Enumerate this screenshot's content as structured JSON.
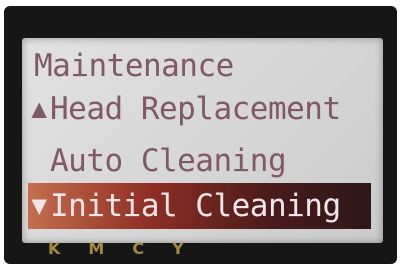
{
  "screen": {
    "title": "Maintenance",
    "menu_items": [
      {
        "label": "Head Replacement",
        "indicator": "▲"
      },
      {
        "label": "Auto Cleaning",
        "indicator": ""
      },
      {
        "label": "Initial Cleaning",
        "indicator": "▼",
        "selected": true
      }
    ]
  },
  "ink_labels": [
    "K",
    "M",
    "C",
    "Y"
  ],
  "colors": {
    "lcd_background": "#d9d9d9",
    "text": "#7f5a66",
    "selection": "#8f2f24",
    "ink_label": "#a48a3a"
  }
}
